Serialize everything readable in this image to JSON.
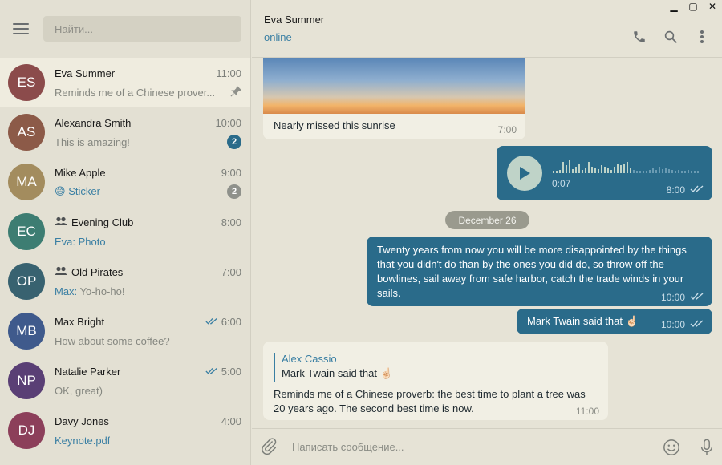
{
  "window": {
    "minimize": "▁",
    "maximize": "▢",
    "close": "✕"
  },
  "sidebar": {
    "search_placeholder": "Найти...",
    "chats": [
      {
        "initials": "ES",
        "color": "#8b4b4b",
        "name": "Eva Summer",
        "time": "11:00",
        "preview": "Reminds me of a Chinese prover...",
        "pinned": true
      },
      {
        "initials": "AS",
        "color": "#8c5a48",
        "name": "Alexandra Smith",
        "time": "10:00",
        "preview": "This is amazing!",
        "badge": "2"
      },
      {
        "initials": "MA",
        "color": "#a38c5e",
        "name": "Mike Apple",
        "time": "9:00",
        "preview_emoji": "😄",
        "preview": "Sticker",
        "badge": "2",
        "badge_muted": true
      },
      {
        "initials": "EC",
        "color": "#3d7d72",
        "name": "Evening Club",
        "time": "8:00",
        "preview": "Eva: Photo",
        "group": true
      },
      {
        "initials": "OP",
        "color": "#386270",
        "name": "Old Pirates",
        "time": "7:00",
        "preview_sender": "Max:",
        "preview": "Yo-ho-ho!",
        "group": true
      },
      {
        "initials": "MB",
        "color": "#3f5a8c",
        "name": "Max Bright",
        "time": "6:00",
        "preview": "How about some coffee?",
        "read": true
      },
      {
        "initials": "NP",
        "color": "#5a3f75",
        "name": "Natalie Parker",
        "time": "5:00",
        "preview": "OK, great)",
        "read": true
      },
      {
        "initials": "DJ",
        "color": "#8c3f5a",
        "name": "Davy Jones",
        "time": "4:00",
        "preview": "Keynote.pdf"
      }
    ]
  },
  "header": {
    "name": "Eva Summer",
    "status": "online"
  },
  "messages": {
    "photo_caption": "Nearly missed this sunrise",
    "photo_time": "7:00",
    "voice_duration": "0:07",
    "voice_time": "8:00",
    "date": "December 26",
    "long_text": "Twenty years from now you will be more disappointed by the things that you didn't do than by the ones you did do, so throw off the bowlines, sail away from safe harbor, catch the trade winds in your sails.",
    "long_time": "10:00",
    "short_text": "Mark Twain said that ☝🏻",
    "short_time": "10:00",
    "reply_name": "Alex Cassio",
    "reply_quote": "Mark Twain said that ☝🏻",
    "reply_text": "Reminds me of a Chinese proverb: the best time to plant a tree was 20 years ago. The second best time is now.",
    "reply_time": "11:00"
  },
  "composer": {
    "placeholder": "Написать сообщение..."
  },
  "colors": {
    "accent": "#2a6b8a",
    "link": "#3a7fa3",
    "background": "#e6e3d6"
  }
}
